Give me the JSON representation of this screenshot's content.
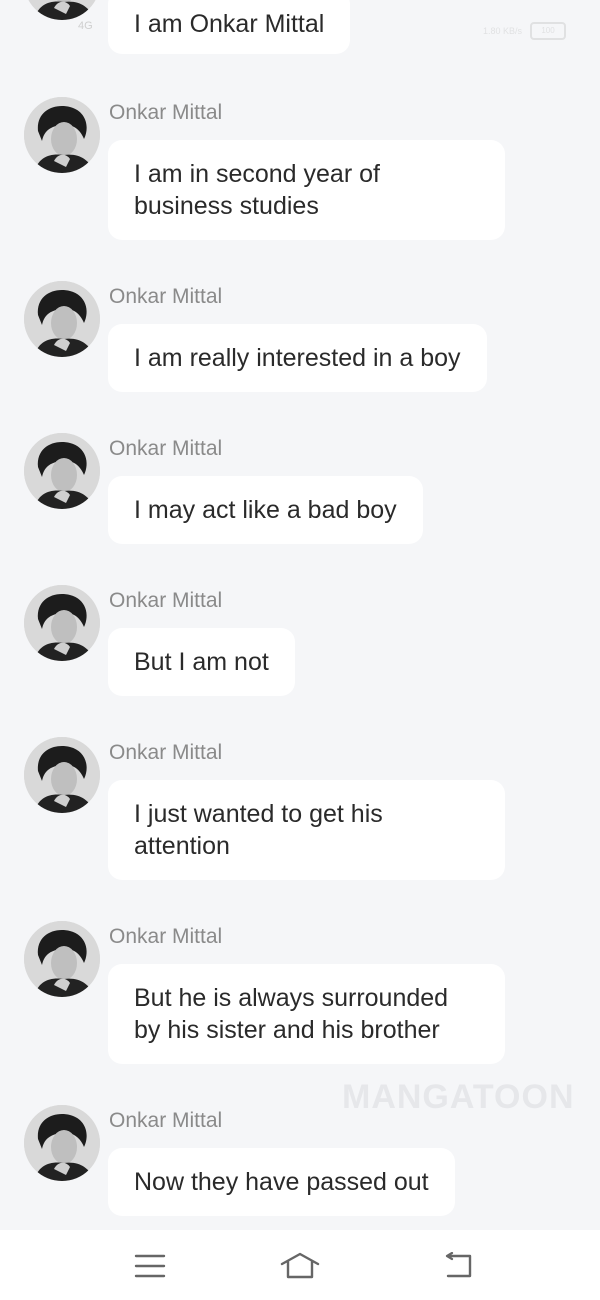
{
  "status_bar": {
    "network": "4G",
    "speed": "1.80 KB/s",
    "battery": "100"
  },
  "top_message": {
    "text": "I am Onkar Mittal"
  },
  "messages": [
    {
      "sender": "Onkar Mittal",
      "text": "I am in second year of business studies"
    },
    {
      "sender": "Onkar Mittal",
      "text": "I am really interested in a boy"
    },
    {
      "sender": "Onkar Mittal",
      "text": "I may act like a bad boy"
    },
    {
      "sender": "Onkar Mittal",
      "text": "But I am not"
    },
    {
      "sender": "Onkar Mittal",
      "text": "I just wanted to get his attention"
    },
    {
      "sender": "Onkar Mittal",
      "text": "But he is always surrounded by his sister and his brother"
    },
    {
      "sender": "Onkar Mittal",
      "text": "Now they have passed out"
    }
  ],
  "watermark": "MANGATOON",
  "navbar": {
    "icons": [
      "menu-icon",
      "home-icon",
      "back-icon"
    ]
  }
}
